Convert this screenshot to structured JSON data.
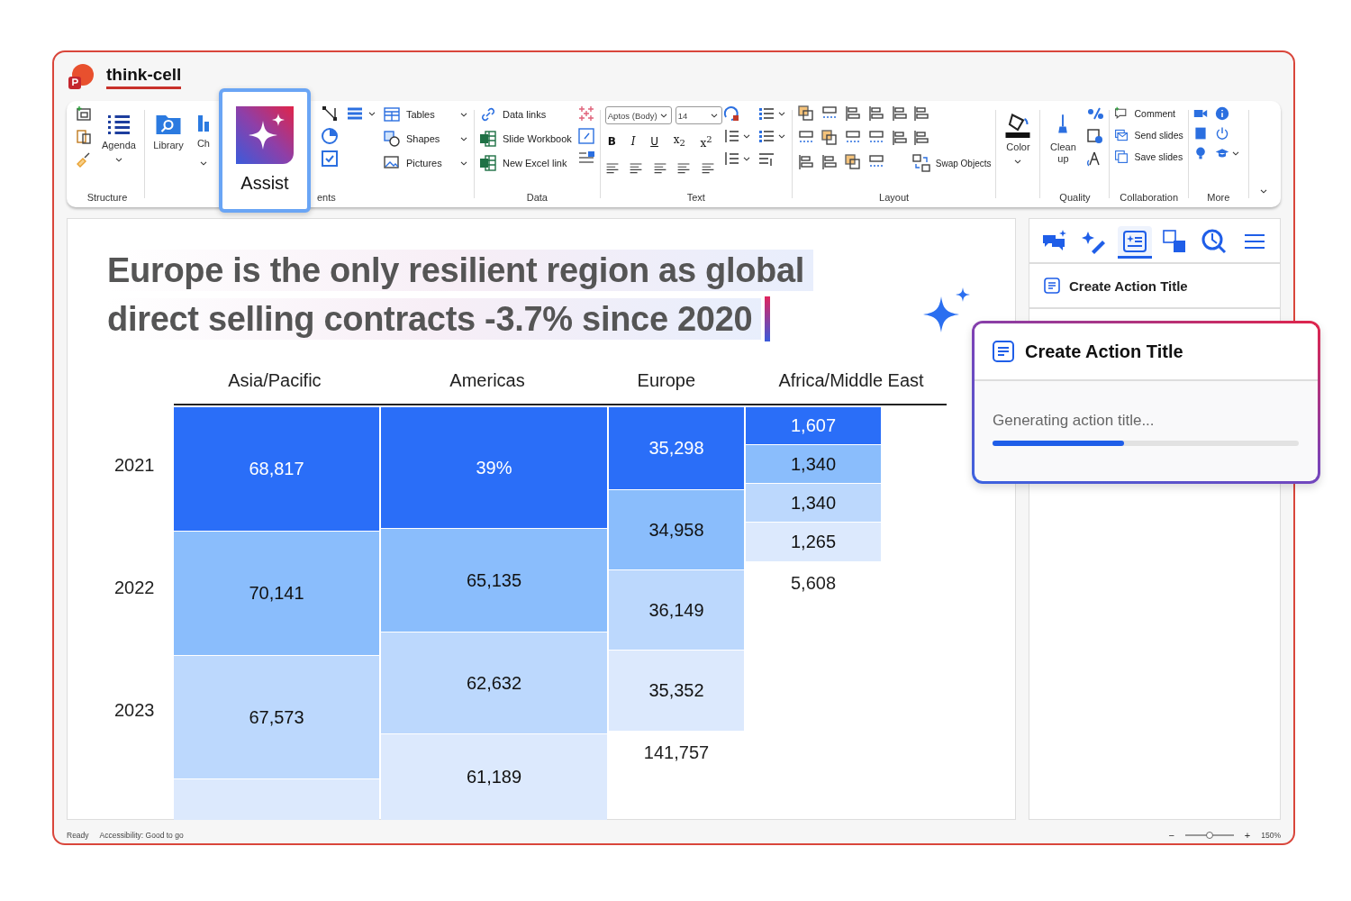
{
  "app": {
    "title": "think-cell",
    "selected": true
  },
  "structure": {
    "label": "Structure",
    "agenda": "Agenda"
  },
  "elements": {
    "label": "ents",
    "library": "Library",
    "chart": "Ch",
    "menus": [
      {
        "label": "Tables"
      },
      {
        "label": "Shapes"
      },
      {
        "label": "Pictures"
      }
    ]
  },
  "assist": {
    "label": "Assist"
  },
  "data": {
    "label": "Data",
    "links": [
      "Data links",
      "Slide Workbook",
      "New Excel link"
    ]
  },
  "text": {
    "label": "Text",
    "font": "Aptos (Body)",
    "size": "14",
    "format": [
      "B",
      "I",
      "U",
      "x$_{2}$",
      "x$^{2}$"
    ]
  },
  "layout": {
    "label": "Layout",
    "swap": "Swap Objects"
  },
  "color": {
    "label": "Color"
  },
  "quality": {
    "label": "Quality",
    "clean": "Clean up"
  },
  "collaboration": {
    "label": "Collaboration",
    "items": [
      "Comment",
      "Send slides",
      "Save slides"
    ]
  },
  "more": {
    "label": "More"
  },
  "slide": {
    "title_lines": [
      "Europe is the only resilient region as global",
      "direct selling contracts -3.7% since 2020"
    ],
    "chart": {
      "row_labels": [
        "2021",
        "2022",
        "2023"
      ],
      "columns": [
        {
          "header": "Asia/Pacific",
          "segments": [
            {
              "label": "68,817",
              "kind": "dark"
            },
            {
              "label": "70,141",
              "kind": "medium"
            },
            {
              "label": "67,573",
              "kind": "light"
            },
            {
              "kind": "pale"
            }
          ]
        },
        {
          "header": "Americas",
          "segments": [
            {
              "label": "39%",
              "kind": "dark"
            },
            {
              "label": "65,135",
              "kind": "medium"
            },
            {
              "label": "62,632",
              "kind": "light"
            },
            {
              "label": "61,189",
              "kind": "pale"
            }
          ]
        },
        {
          "header": "Europe",
          "segments": [
            {
              "label": "35,298",
              "kind": "dark"
            },
            {
              "label": "34,958",
              "kind": "medium"
            },
            {
              "label": "36,149",
              "kind": "light"
            },
            {
              "label": "35,352",
              "kind": "pale"
            }
          ],
          "total": "141,757"
        },
        {
          "header": "Africa/Middle East",
          "segments": [
            {
              "label": "1,607",
              "kind": "dark"
            },
            {
              "label": "1,340",
              "kind": "medium"
            },
            {
              "label": "1,340",
              "kind": "light"
            },
            {
              "label": "1,265",
              "kind": "pale"
            }
          ],
          "total": "5,608"
        }
      ]
    }
  },
  "panel": {
    "tabs": [
      {
        "selected": false
      },
      {
        "selected": false
      },
      {
        "selected": true
      },
      {
        "selected": false
      },
      {
        "selected": false
      },
      {
        "selected": false
      }
    ],
    "item": "Create Action Title"
  },
  "popup": {
    "title": "Create Action Title",
    "status": "Generating action title...",
    "level": 0.43
  },
  "status_bar": {
    "ready": "Ready",
    "accessibility": "Accessibility: Good to go",
    "zoom_out": "−",
    "zoom_in": "+",
    "zoom_slider": {
      "level": 0.5
    },
    "zoom": "150%"
  }
}
